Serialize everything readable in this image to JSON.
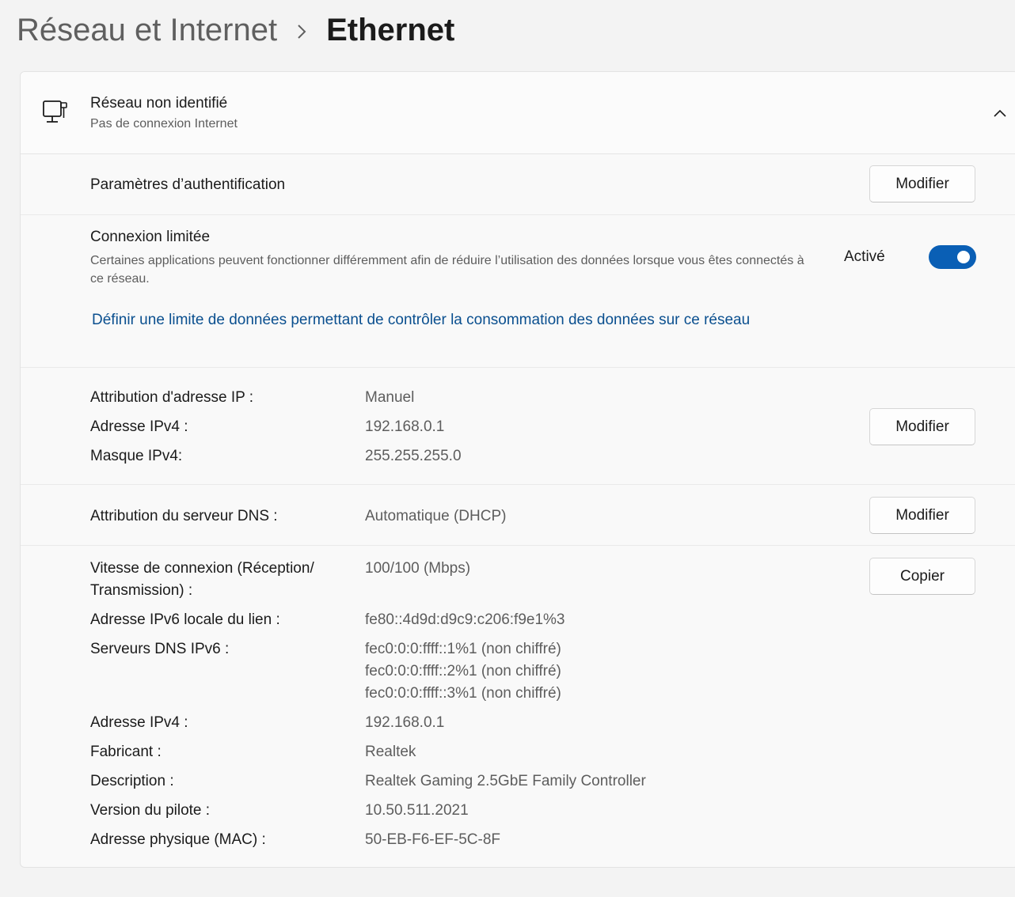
{
  "breadcrumb": {
    "parent": "Réseau et Internet",
    "separator_icon": "chevron-right-icon",
    "current": "Ethernet"
  },
  "network": {
    "icon": "wired-network-icon",
    "title": "Réseau non identifié",
    "subtitle": "Pas de connexion Internet",
    "collapse_icon": "chevron-up-icon"
  },
  "authentication": {
    "label": "Paramètres d’authentification",
    "button": "Modifier"
  },
  "metered": {
    "label": "Connexion limitée",
    "description": "Certaines applications peuvent fonctionner différemment afin de réduire l’utilisation des données lorsque vous êtes connectés à ce réseau.",
    "state_label": "Activé",
    "enabled": true,
    "link": "Définir une limite de données permettant de contrôler la consommation des données sur ce réseau"
  },
  "ip_settings": {
    "button": "Modifier",
    "rows": [
      {
        "label": "Attribution d'adresse IP :",
        "value": "Manuel"
      },
      {
        "label": "Adresse IPv4 :",
        "value": "192.168.0.1"
      },
      {
        "label": "Masque IPv4:",
        "value": "255.255.255.0"
      }
    ]
  },
  "dns_settings": {
    "label": "Attribution du serveur DNS :",
    "value": "Automatique (DHCP)",
    "button": "Modifier"
  },
  "properties": {
    "button": "Copier",
    "speed_label_line1": "Vitesse de connexion (Réception/",
    "speed_label_line2": "Transmission) :",
    "speed_value": "100/100 (Mbps)",
    "ipv6_local_label": "Adresse IPv6 locale du lien :",
    "ipv6_local_value": "fe80::4d9d:d9c9:c206:f9e1%3",
    "dns_ipv6_label": "Serveurs DNS IPv6 :",
    "dns_ipv6_values": [
      "fec0:0:0:ffff::1%1 (non chiffré)",
      "fec0:0:0:ffff::2%1 (non chiffré)",
      "fec0:0:0:ffff::3%1 (non chiffré)"
    ],
    "ipv4_label": "Adresse IPv4 :",
    "ipv4_value": "192.168.0.1",
    "manufacturer_label": "Fabricant :",
    "manufacturer_value": "Realtek",
    "description_label": "Description :",
    "description_value": "Realtek Gaming 2.5GbE Family Controller",
    "driver_label": "Version du pilote :",
    "driver_value": "10.50.511.2021",
    "mac_label": "Adresse physique (MAC) :",
    "mac_value": "50-EB-F6-EF-5C-8F"
  }
}
